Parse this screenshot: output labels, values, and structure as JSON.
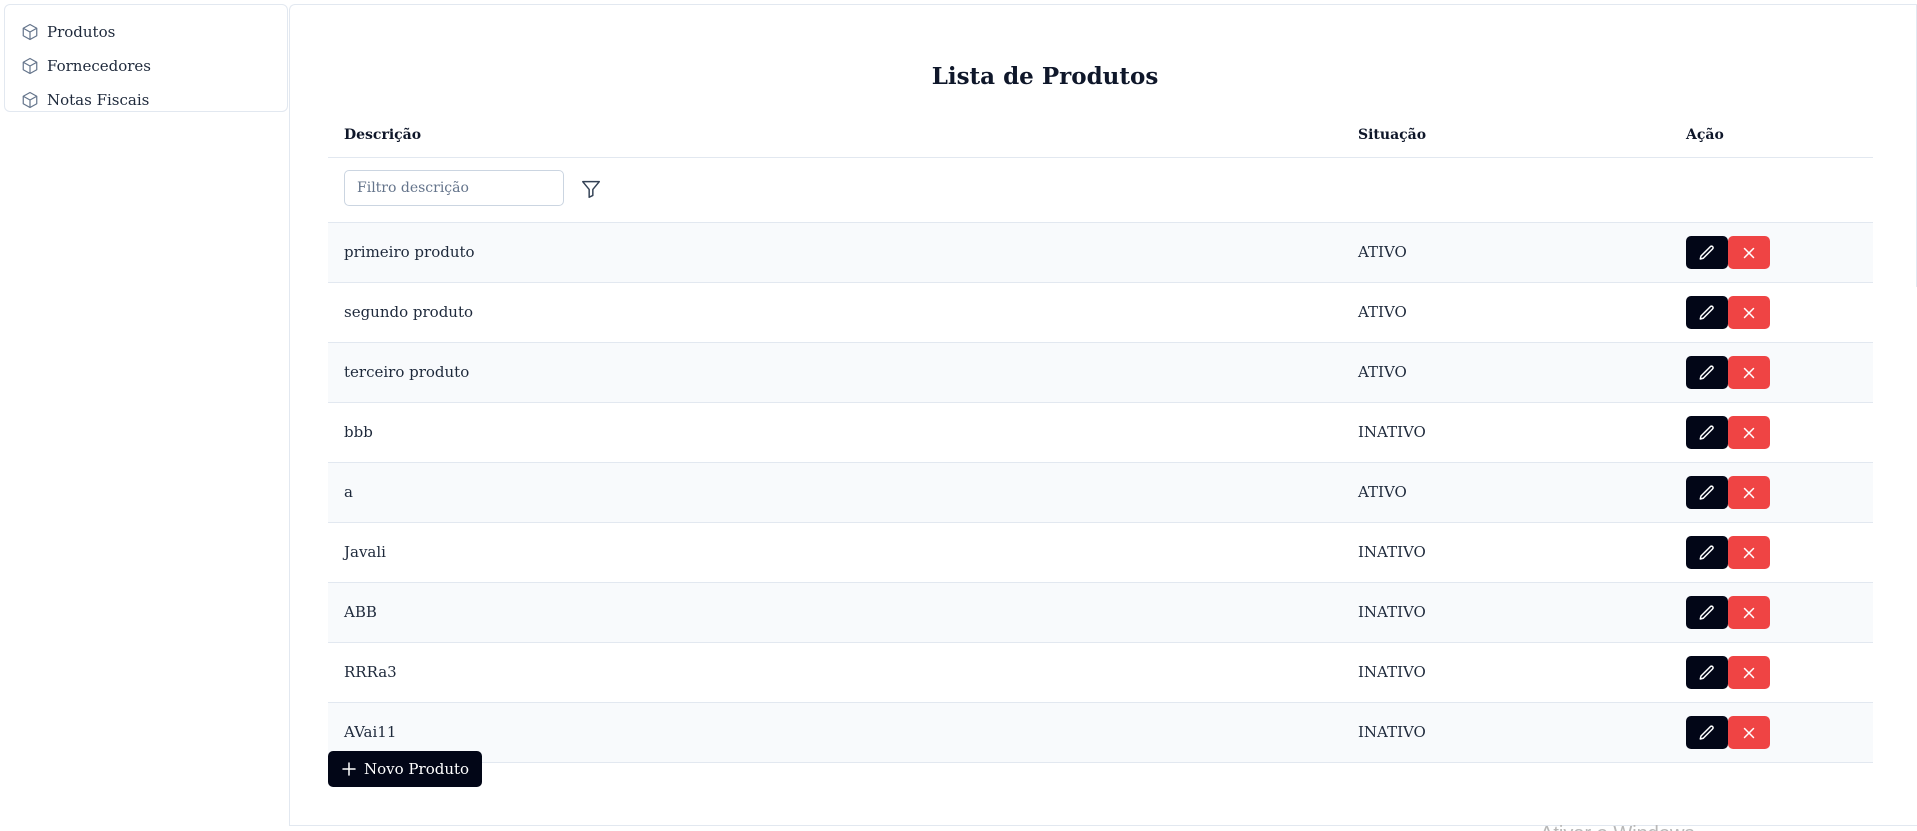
{
  "sidebar": {
    "items": [
      {
        "label": "Produtos",
        "icon": "box-icon"
      },
      {
        "label": "Fornecedores",
        "icon": "box-icon"
      },
      {
        "label": "Notas Fiscais",
        "icon": "box-icon"
      }
    ]
  },
  "main": {
    "title": "Lista de Produtos",
    "columns": {
      "descricao": "Descrição",
      "situacao": "Situação",
      "acao": "Ação"
    },
    "filter": {
      "placeholder": "Filtro descrição",
      "value": ""
    },
    "rows": [
      {
        "descricao": "primeiro produto",
        "situacao": "ATIVO"
      },
      {
        "descricao": "segundo produto",
        "situacao": "ATIVO"
      },
      {
        "descricao": "terceiro produto",
        "situacao": "ATIVO"
      },
      {
        "descricao": "bbb",
        "situacao": "INATIVO"
      },
      {
        "descricao": "a",
        "situacao": "ATIVO"
      },
      {
        "descricao": "Javali",
        "situacao": "INATIVO"
      },
      {
        "descricao": "ABB",
        "situacao": "INATIVO"
      },
      {
        "descricao": "RRRa3",
        "situacao": "INATIVO"
      },
      {
        "descricao": "AVai11",
        "situacao": "INATIVO"
      }
    ],
    "new_button_label": "Novo Produto"
  },
  "colors": {
    "edit_button": "#020617",
    "delete_button": "#ef4444",
    "row_alt": "#f8fafc"
  },
  "watermark": "Ativar o Windows"
}
